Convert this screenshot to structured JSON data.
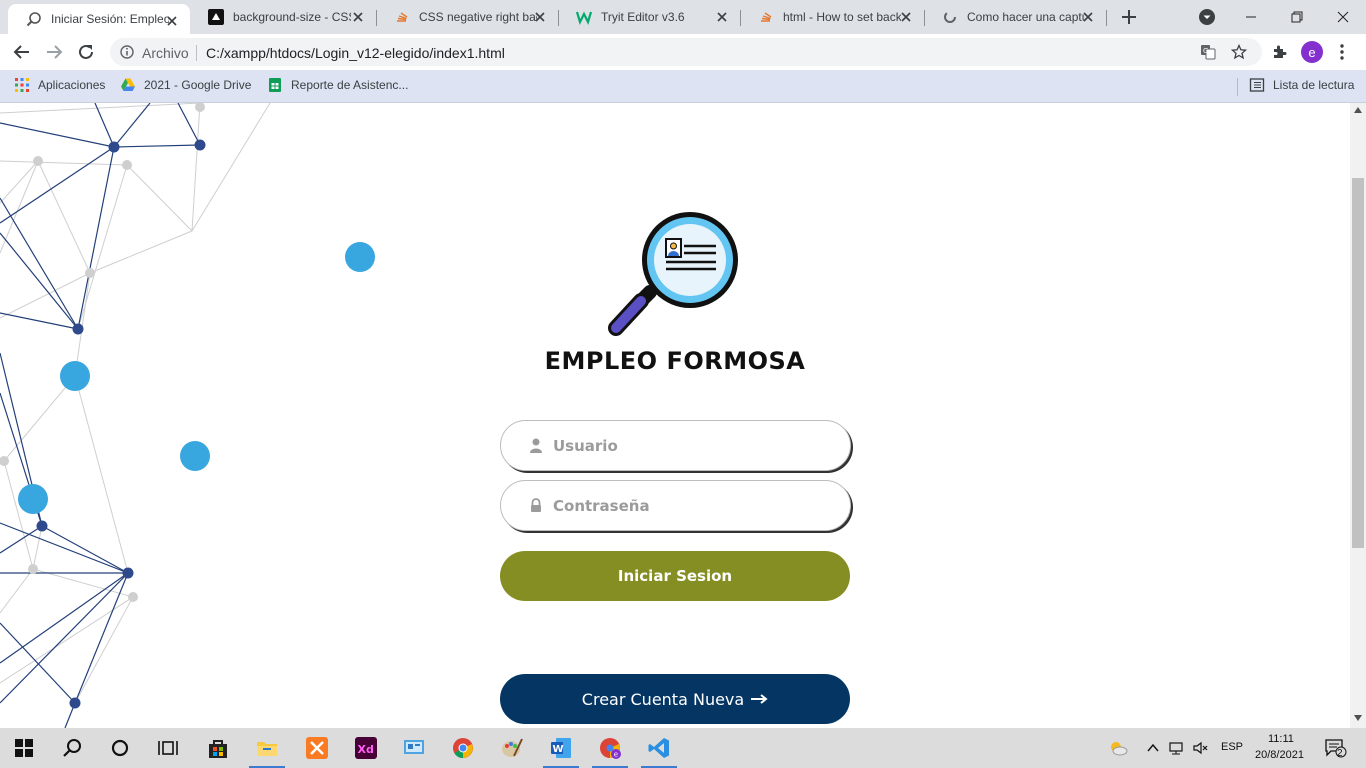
{
  "browser": {
    "tabs": [
      {
        "title": "Iniciar Sesión: Empleo",
        "active": true,
        "icon": "magnifier-icon"
      },
      {
        "title": "background-size - CSS",
        "active": false,
        "icon": "mdn-icon"
      },
      {
        "title": "CSS negative right bac",
        "active": false,
        "icon": "stackoverflow-icon"
      },
      {
        "title": "Tryit Editor v3.6",
        "active": false,
        "icon": "w3schools-icon"
      },
      {
        "title": "html - How to set back",
        "active": false,
        "icon": "stackoverflow-icon"
      },
      {
        "title": "Como hacer una captu",
        "active": false,
        "icon": "loading-icon"
      }
    ],
    "security_label": "Archivo",
    "url": "C:/xampp/htdocs/Login_v12-elegido/index1.html",
    "profile_initial": "e",
    "bookmarks": [
      {
        "label": "Aplicaciones",
        "icon": "apps-grid-icon"
      },
      {
        "label": "2021 - Google Drive",
        "icon": "google-drive-icon"
      },
      {
        "label": "Reporte de Asistenc...",
        "icon": "google-sheets-icon"
      }
    ],
    "reading_list": "Lista de lectura"
  },
  "page": {
    "brand_title": "EMPLEO FORMOSA",
    "username_placeholder": "Usuario",
    "password_placeholder": "Contraseña",
    "login_label": "Iniciar Sesion",
    "create_account_label": "Crear Cuenta Nueva",
    "colors": {
      "login_button": "#858e22",
      "create_button": "#053663",
      "network_line": "#24407a",
      "network_dot": "#2e4a8c",
      "accent_dot": "#38a7e0"
    }
  },
  "taskbar": {
    "apps": [
      "windows-start-icon",
      "search-icon",
      "cortana-icon",
      "task-view-icon",
      "store-icon",
      "file-explorer-icon",
      "xampp-icon",
      "adobe-xd-icon",
      "control-panel-icon",
      "chrome-icon",
      "paint-icon",
      "word-icon",
      "chrome-profile-icon",
      "vscode-icon"
    ],
    "language": "ESP",
    "time": "11:11",
    "date": "20/8/2021",
    "notifications": "2"
  }
}
